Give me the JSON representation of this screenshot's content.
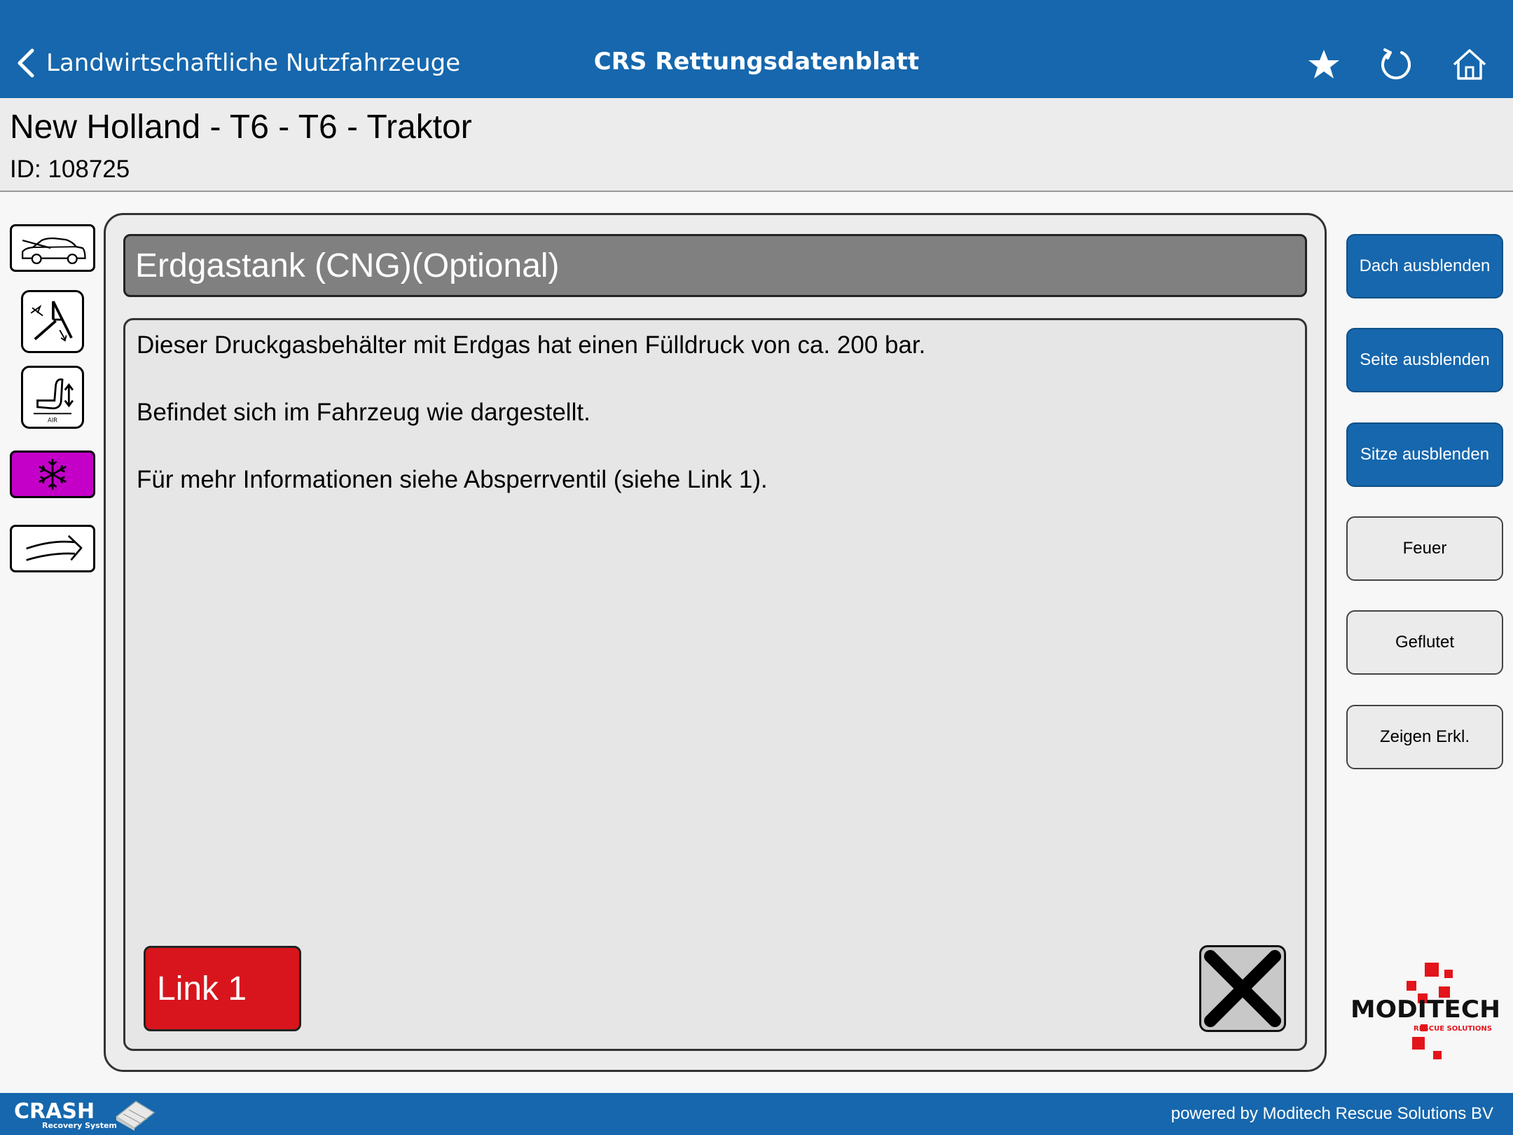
{
  "nav": {
    "back_label": "Landwirtschaftliche Nutzfahrzeuge",
    "title": "CRS Rettungsdatenblatt",
    "icons": [
      "star-icon",
      "refresh-icon",
      "home-icon"
    ]
  },
  "vehicle": {
    "title": "New Holland - T6 - T6 - Traktor",
    "id": "ID: 108725"
  },
  "left_icons": [
    {
      "name": "car-hood-icon",
      "active": false
    },
    {
      "name": "airbag-icon",
      "active": false
    },
    {
      "name": "seat-adjust-air-icon",
      "active": false,
      "label": "AIR"
    },
    {
      "name": "snowflake-cng-icon",
      "active": true
    },
    {
      "name": "arrow-right-icon",
      "active": false
    }
  ],
  "panel": {
    "heading": "Erdgastank (CNG)(Optional)",
    "paragraphs": [
      "Dieser Druckgasbehälter mit Erdgas hat einen Fülldruck von ca. 200 bar.",
      "Befindet sich im Fahrzeug wie dargestellt.",
      "Für mehr Informationen siehe Absperrventil (siehe Link 1)."
    ],
    "link_label": "Link 1"
  },
  "side_buttons": [
    {
      "label": "Dach ausblenden",
      "style": "blue"
    },
    {
      "label": "Seite ausblenden",
      "style": "blue"
    },
    {
      "label": "Sitze ausblenden",
      "style": "blue"
    },
    {
      "label": "Feuer",
      "style": "grey"
    },
    {
      "label": "Geflutet",
      "style": "grey"
    },
    {
      "label": "Zeigen Erkl.",
      "style": "grey"
    }
  ],
  "logo": {
    "brand": "MODITECH",
    "tagline": "RESCUE SOLUTIONS"
  },
  "footer": {
    "app_logo": "CRASH",
    "app_logo_sub": "Recovery System",
    "powered_by": "powered by Moditech Rescue Solutions BV"
  },
  "colors": {
    "brand_blue": "#1667ad",
    "active_icon": "#c400c8",
    "link_red": "#d8151c",
    "heading_grey": "#808080",
    "logo_red": "#e3141b"
  }
}
